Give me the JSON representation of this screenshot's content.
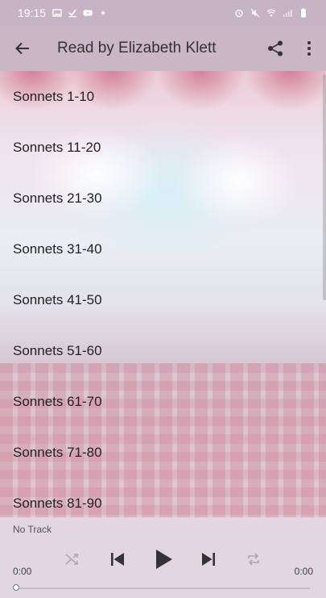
{
  "status_bar": {
    "time": "19:15"
  },
  "app_bar": {
    "title": "Read by Elizabeth Klett"
  },
  "list": {
    "items": [
      {
        "label": "Sonnets 1-10"
      },
      {
        "label": "Sonnets 11-20"
      },
      {
        "label": "Sonnets 21-30"
      },
      {
        "label": "Sonnets 31-40"
      },
      {
        "label": "Sonnets 41-50"
      },
      {
        "label": "Sonnets 51-60"
      },
      {
        "label": "Sonnets 61-70"
      },
      {
        "label": "Sonnets 71-80"
      },
      {
        "label": "Sonnets 81-90"
      }
    ]
  },
  "player": {
    "track_name": "No Track",
    "elapsed": "0:00",
    "duration": "0:00",
    "progress": 0
  },
  "icons": {
    "back": "arrow-left-icon",
    "share": "share-icon",
    "more": "more-vert-icon",
    "shuffle": "shuffle-icon",
    "previous": "skip-previous-icon",
    "play": "play-icon",
    "next": "skip-next-icon",
    "repeat": "repeat-icon"
  }
}
